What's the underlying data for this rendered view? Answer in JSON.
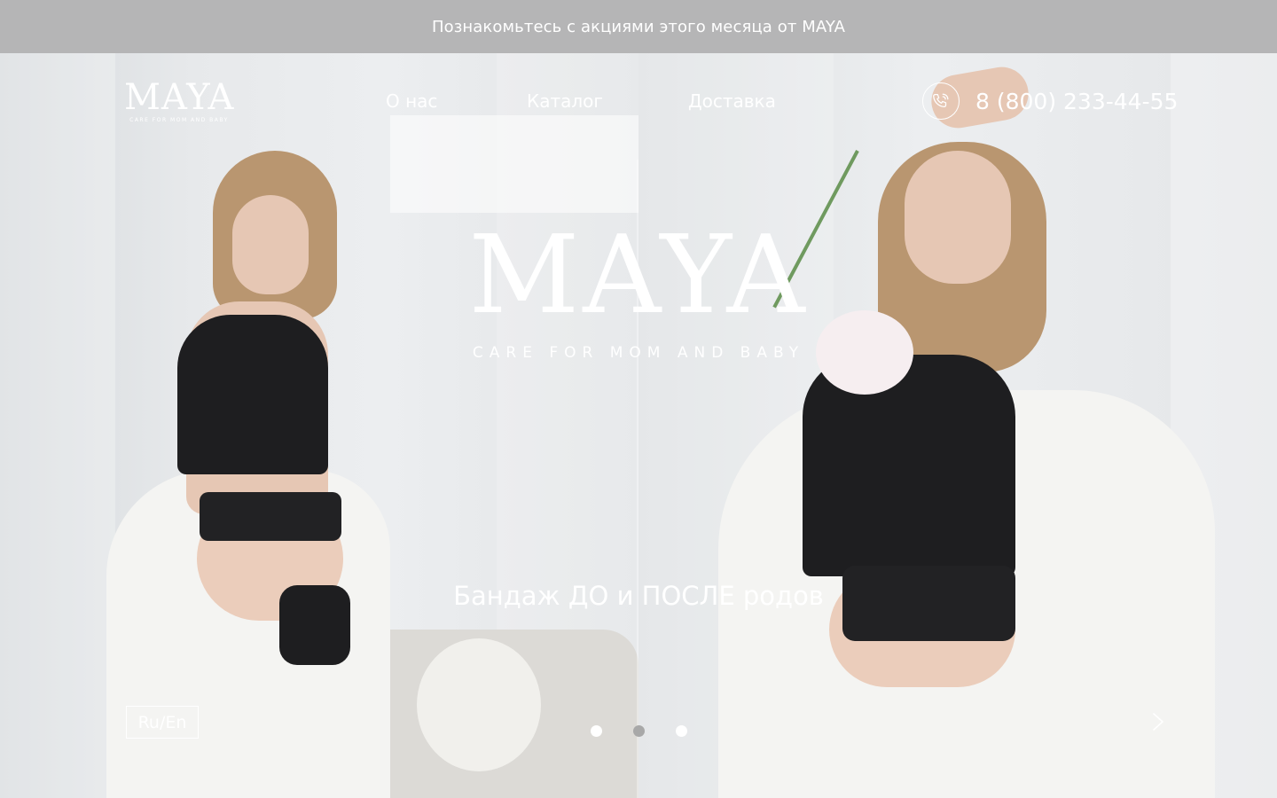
{
  "promo": {
    "text": "Познакомьтесь с акциями этого месяца от MAYA"
  },
  "header": {
    "logo": {
      "word": "MAYA",
      "tagline": "CARE FOR MOM AND BABY"
    },
    "nav": [
      {
        "label": "О нас"
      },
      {
        "label": "Каталог"
      },
      {
        "label": "Доставка"
      }
    ],
    "phone": {
      "icon": "phone-call-icon",
      "number": "8 (800) 233-44-55"
    }
  },
  "hero": {
    "brand_word": "MAYA",
    "brand_tagline": "CARE FOR MOM AND BABY",
    "slide_title": "Бандаж ДО и ПОСЛЕ родов",
    "language_toggle": "Ru/En",
    "slider": {
      "total": 3,
      "active_index": 1,
      "next_icon": "chevron-right-icon"
    }
  },
  "colors": {
    "promo_bg": "#b5b5b6",
    "text_on_photo": "#ffffff",
    "dot_inactive": "#ffffff",
    "dot_active": "#a8a8a8",
    "garment": "#1e1e20",
    "shirt": "#f4f4f2",
    "skin": "#e6c7b4",
    "hair": "#b99670"
  }
}
